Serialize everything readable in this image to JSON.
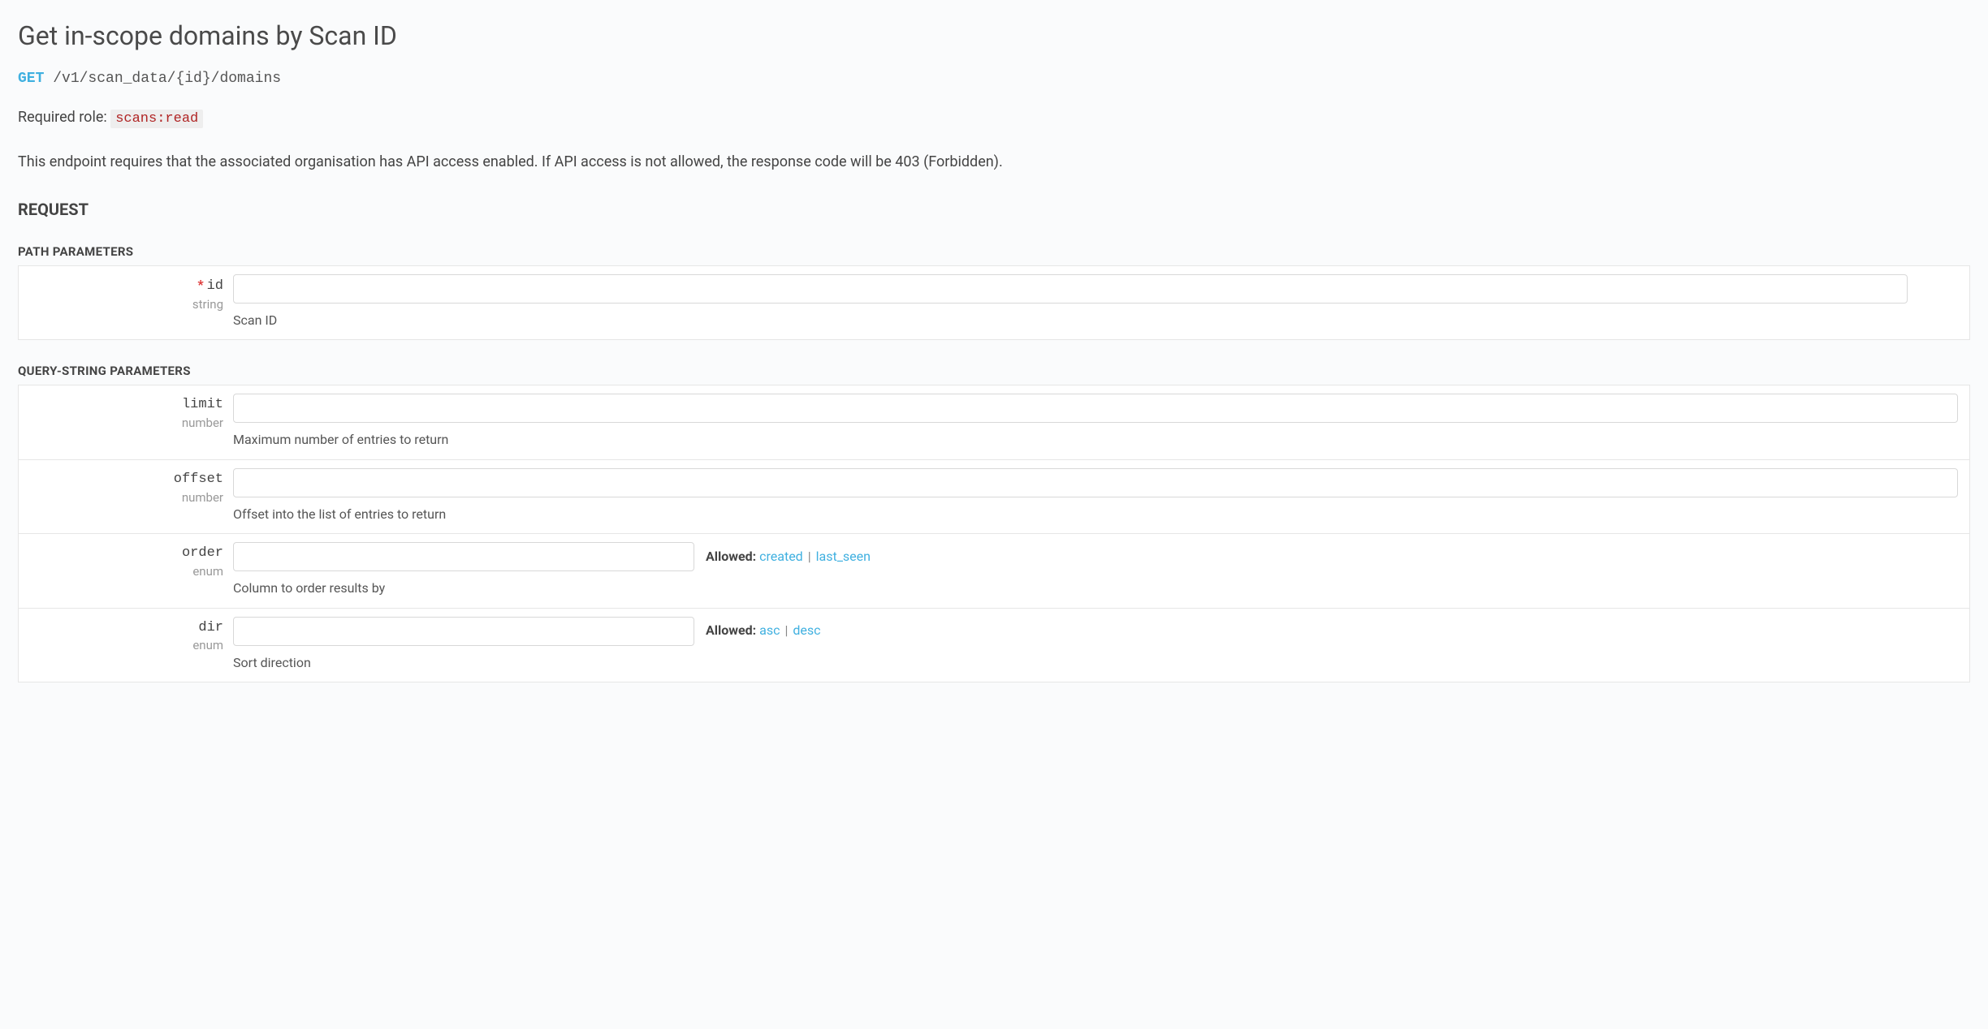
{
  "title": "Get in-scope domains by Scan ID",
  "endpoint": {
    "method": "GET",
    "path": "/v1/scan_data/{id}/domains"
  },
  "role": {
    "label": "Required role:",
    "value": "scans:read"
  },
  "description": "This endpoint requires that the associated organisation has API access enabled. If API access is not allowed, the response code will be 403 (Forbidden).",
  "request_heading": "REQUEST",
  "path_params_heading": "PATH PARAMETERS",
  "query_params_heading": "QUERY-STRING PARAMETERS",
  "allowed_label": "Allowed:",
  "path_params": {
    "id": {
      "name": "id",
      "type": "string",
      "required_mark": "*",
      "desc": "Scan ID"
    }
  },
  "query_params": {
    "limit": {
      "name": "limit",
      "type": "number",
      "desc": "Maximum number of entries to return"
    },
    "offset": {
      "name": "offset",
      "type": "number",
      "desc": "Offset into the list of entries to return"
    },
    "order": {
      "name": "order",
      "type": "enum",
      "desc": "Column to order results by",
      "allowed": {
        "a": "created",
        "b": "last_seen"
      }
    },
    "dir": {
      "name": "dir",
      "type": "enum",
      "desc": "Sort direction",
      "allowed": {
        "a": "asc",
        "b": "desc"
      }
    }
  }
}
